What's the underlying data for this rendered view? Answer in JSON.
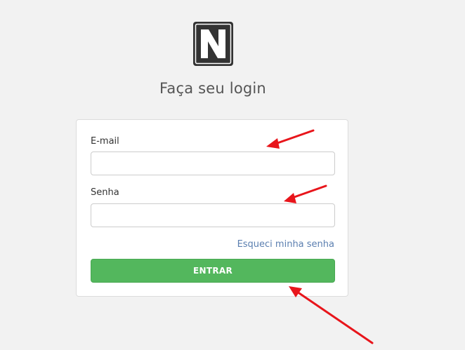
{
  "logo": {
    "icon": "n-logo-icon",
    "color": "#333333"
  },
  "heading": "Faça seu login",
  "form": {
    "email_label": "E-mail",
    "email_value": "",
    "password_label": "Senha",
    "password_value": "",
    "forgot_link": "Esqueci minha senha",
    "submit_label": "ENTRAR"
  },
  "annotations": {
    "arrow_color": "#e8151b",
    "arrows": [
      "arrow-icon",
      "arrow-icon",
      "arrow-icon"
    ]
  },
  "colors": {
    "background": "#f2f2f2",
    "button": "#53b75d",
    "link": "#5b7fb0"
  }
}
